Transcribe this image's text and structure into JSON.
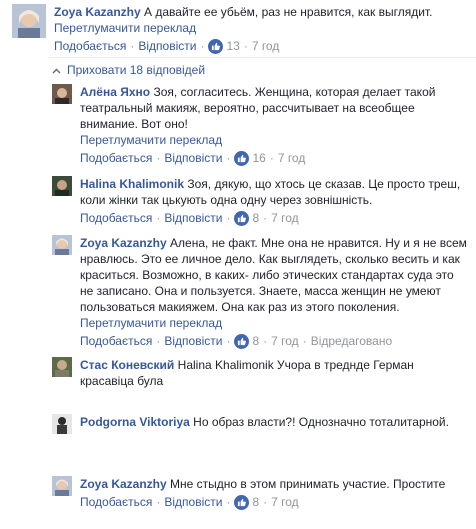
{
  "labels": {
    "like": "Подобається",
    "reply": "Відповісти",
    "translate": "Перетлумачити переклад",
    "edited": "Відредаговано",
    "dot": "·"
  },
  "hide_replies": "Приховати 18 відповідей",
  "colors": {
    "link": "#385898",
    "author": "#365899",
    "meta": "#90949c",
    "like_badge": "#4267b2"
  },
  "comments": [
    {
      "author": "Zoya Kazanzhy",
      "text": "А давайте ее убьём, раз не нравится, как выглядит.",
      "likes": "13",
      "time": "7 год"
    },
    {
      "author": "Алёна Яхно",
      "text": "Зоя, согласитесь. Женщина, которая делает такой театральный макияж, вероятно, рассчитывает на всеобщее внимание. Вот оно!",
      "likes": "16",
      "time": "7 год"
    },
    {
      "author": "Halina Khalimonik",
      "text": "Зоя, дякую, що хтось це сказав. Це просто треш, коли жінки так цькують одна одну через зовнішність.",
      "likes": "8",
      "time": "7 год"
    },
    {
      "author": "Zoya Kazanzhy",
      "text": "Алена, не факт. Мне она не нравится. Ну и я не всем нравлюсь. Это ее личное дело. Как выглядеть, сколько весить и как краситься. Возможно, в каких- либо этических стандартах суда это не записано. Она и пользуется. Знаете, масса женщин не умеют пользоваться макияжем. Она как раз из этого поколения.",
      "likes": "8",
      "time": "7 год"
    },
    {
      "author": "Стас Коневский",
      "text": "Halina Khalimonik Учора в треднде Герман красавіца була"
    },
    {
      "author": "Podgorna Viktoriya",
      "text": "Но образ власти?! Однозначно тоталитарной."
    },
    {
      "author": "Zoya Kazanzhy",
      "text": "Мне стыдно в этом принимать участие. Простите",
      "likes": "8",
      "time": "7 год"
    }
  ]
}
